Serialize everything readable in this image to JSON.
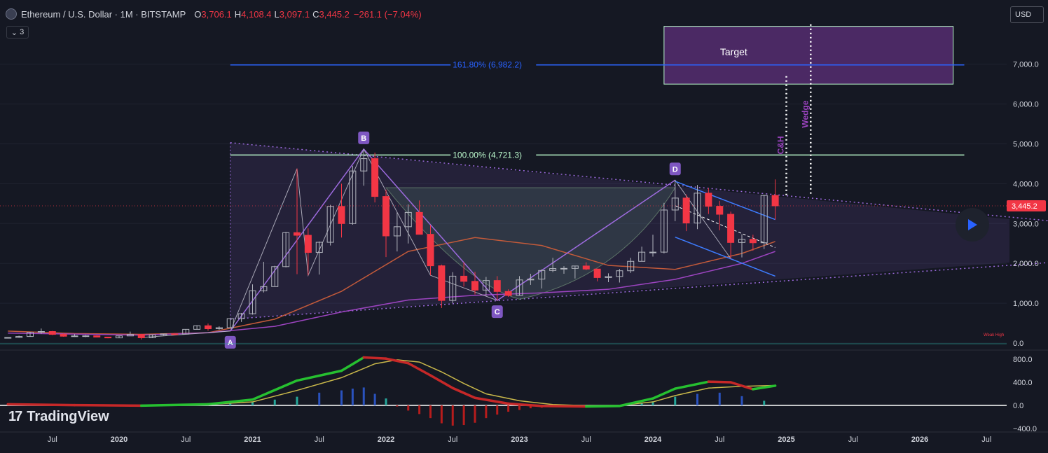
{
  "header": {
    "symbol_title": "Ethereum / U.S. Dollar · 1M · BITSTAMP",
    "ohlc": [
      {
        "k": "O",
        "v": "3,706.1"
      },
      {
        "k": "H",
        "v": "4,108.4"
      },
      {
        "k": "L",
        "v": "3,097.1"
      },
      {
        "k": "C",
        "v": "3,445.2"
      }
    ],
    "change": "−261.1 (−7.04%)",
    "indicators_count": "3",
    "currency": "USD"
  },
  "brand": {
    "name": "TradingView",
    "mark": "17"
  },
  "colors": {
    "background": "#151823",
    "up": "#b2b5be",
    "down": "#f23645",
    "fib_161": "#2962ff",
    "fib_100": "#b9f6ca",
    "pattern": "#9c6ade",
    "target_box": "#8e3fb4",
    "macd_up": "#26c030",
    "macd_down": "#c62828",
    "signal": "#c9b84a"
  },
  "chart_data": [
    {
      "type": "candlestick",
      "title": "Ethereum / U.S. Dollar · 1M · BITSTAMP",
      "y_scale": "linear",
      "ylim": [
        0,
        8000
      ],
      "y_ticks": [
        "0.0",
        "1,000.0",
        "2,000.0",
        "3,000.0",
        "4,000.0",
        "5,000.0",
        "6,000.0",
        "7,000.0"
      ],
      "x_ticks": [
        "Jul",
        "2020",
        "Jul",
        "2021",
        "Jul",
        "2022",
        "Jul",
        "2023",
        "Jul",
        "2024",
        "Jul",
        "2025",
        "Jul",
        "2026",
        "Jul"
      ],
      "last_price_label": "3,445.2",
      "candles": [
        {
          "t": "2019-03",
          "o": 135,
          "h": 145,
          "l": 130,
          "c": 140
        },
        {
          "t": "2019-04",
          "o": 140,
          "h": 185,
          "l": 150,
          "c": 165
        },
        {
          "t": "2019-05",
          "o": 165,
          "h": 280,
          "l": 160,
          "c": 270
        },
        {
          "t": "2019-06",
          "o": 270,
          "h": 365,
          "l": 230,
          "c": 290
        },
        {
          "t": "2019-07",
          "o": 290,
          "h": 305,
          "l": 200,
          "c": 218
        },
        {
          "t": "2019-08",
          "o": 218,
          "h": 240,
          "l": 160,
          "c": 172
        },
        {
          "t": "2019-09",
          "o": 172,
          "h": 225,
          "l": 155,
          "c": 180
        },
        {
          "t": "2019-10",
          "o": 180,
          "h": 200,
          "l": 150,
          "c": 182
        },
        {
          "t": "2019-11",
          "o": 182,
          "h": 195,
          "l": 140,
          "c": 151
        },
        {
          "t": "2019-12",
          "o": 151,
          "h": 155,
          "l": 120,
          "c": 130
        },
        {
          "t": "2020-01",
          "o": 130,
          "h": 185,
          "l": 127,
          "c": 180
        },
        {
          "t": "2020-02",
          "o": 180,
          "h": 288,
          "l": 210,
          "c": 218
        },
        {
          "t": "2020-03",
          "o": 218,
          "h": 230,
          "l": 90,
          "c": 133
        },
        {
          "t": "2020-04",
          "o": 133,
          "h": 215,
          "l": 130,
          "c": 207
        },
        {
          "t": "2020-05",
          "o": 207,
          "h": 230,
          "l": 190,
          "c": 230
        },
        {
          "t": "2020-06",
          "o": 230,
          "h": 250,
          "l": 215,
          "c": 226
        },
        {
          "t": "2020-07",
          "o": 226,
          "h": 350,
          "l": 220,
          "c": 345
        },
        {
          "t": "2020-08",
          "o": 345,
          "h": 445,
          "l": 340,
          "c": 435
        },
        {
          "t": "2020-09",
          "o": 435,
          "h": 490,
          "l": 310,
          "c": 360
        },
        {
          "t": "2020-10",
          "o": 360,
          "h": 420,
          "l": 335,
          "c": 386
        },
        {
          "t": "2020-11",
          "o": 386,
          "h": 620,
          "l": 375,
          "c": 614
        },
        {
          "t": "2020-12",
          "o": 614,
          "h": 755,
          "l": 530,
          "c": 737
        },
        {
          "t": "2021-01",
          "o": 737,
          "h": 1475,
          "l": 715,
          "c": 1313
        },
        {
          "t": "2021-02",
          "o": 1313,
          "h": 2040,
          "l": 1270,
          "c": 1418
        },
        {
          "t": "2021-03",
          "o": 1418,
          "h": 1940,
          "l": 1430,
          "c": 1919
        },
        {
          "t": "2021-04",
          "o": 1919,
          "h": 2790,
          "l": 1900,
          "c": 2772
        },
        {
          "t": "2021-05",
          "o": 2772,
          "h": 4380,
          "l": 1730,
          "c": 2706
        },
        {
          "t": "2021-06",
          "o": 2706,
          "h": 2880,
          "l": 1700,
          "c": 2275
        },
        {
          "t": "2021-07",
          "o": 2275,
          "h": 2550,
          "l": 1720,
          "c": 2530
        },
        {
          "t": "2021-08",
          "o": 2530,
          "h": 3470,
          "l": 2450,
          "c": 3430
        },
        {
          "t": "2021-09",
          "o": 3430,
          "h": 4000,
          "l": 2650,
          "c": 3000
        },
        {
          "t": "2021-10",
          "o": 3000,
          "h": 4450,
          "l": 2970,
          "c": 4320
        },
        {
          "t": "2021-11",
          "o": 4320,
          "h": 4870,
          "l": 3950,
          "c": 4630
        },
        {
          "t": "2021-12",
          "o": 4630,
          "h": 4780,
          "l": 3530,
          "c": 3680
        },
        {
          "t": "2022-01",
          "o": 3680,
          "h": 3850,
          "l": 2160,
          "c": 2690
        },
        {
          "t": "2022-02",
          "o": 2690,
          "h": 3280,
          "l": 2300,
          "c": 2920
        },
        {
          "t": "2022-03",
          "o": 2920,
          "h": 3480,
          "l": 2500,
          "c": 3280
        },
        {
          "t": "2022-04",
          "o": 3280,
          "h": 3580,
          "l": 2730,
          "c": 2730
        },
        {
          "t": "2022-05",
          "o": 2730,
          "h": 2960,
          "l": 1700,
          "c": 1940
        },
        {
          "t": "2022-06",
          "o": 1940,
          "h": 1970,
          "l": 880,
          "c": 1070
        },
        {
          "t": "2022-07",
          "o": 1070,
          "h": 1780,
          "l": 1000,
          "c": 1680
        },
        {
          "t": "2022-08",
          "o": 1680,
          "h": 2030,
          "l": 1420,
          "c": 1550
        },
        {
          "t": "2022-09",
          "o": 1550,
          "h": 1790,
          "l": 1220,
          "c": 1330
        },
        {
          "t": "2022-10",
          "o": 1330,
          "h": 1660,
          "l": 1190,
          "c": 1570
        },
        {
          "t": "2022-11",
          "o": 1570,
          "h": 1680,
          "l": 1070,
          "c": 1295
        },
        {
          "t": "2022-12",
          "o": 1295,
          "h": 1350,
          "l": 1160,
          "c": 1196
        },
        {
          "t": "2023-01",
          "o": 1196,
          "h": 1680,
          "l": 1190,
          "c": 1585
        },
        {
          "t": "2023-02",
          "o": 1585,
          "h": 1740,
          "l": 1460,
          "c": 1605
        },
        {
          "t": "2023-03",
          "o": 1605,
          "h": 1850,
          "l": 1370,
          "c": 1822
        },
        {
          "t": "2023-04",
          "o": 1822,
          "h": 2140,
          "l": 1780,
          "c": 1870
        },
        {
          "t": "2023-05",
          "o": 1870,
          "h": 1930,
          "l": 1740,
          "c": 1875
        },
        {
          "t": "2023-06",
          "o": 1875,
          "h": 1930,
          "l": 1620,
          "c": 1935
        },
        {
          "t": "2023-07",
          "o": 1935,
          "h": 2030,
          "l": 1830,
          "c": 1858
        },
        {
          "t": "2023-08",
          "o": 1858,
          "h": 1870,
          "l": 1550,
          "c": 1645
        },
        {
          "t": "2023-09",
          "o": 1645,
          "h": 1750,
          "l": 1530,
          "c": 1671
        },
        {
          "t": "2023-10",
          "o": 1671,
          "h": 1860,
          "l": 1520,
          "c": 1815
        },
        {
          "t": "2023-11",
          "o": 1815,
          "h": 2140,
          "l": 1760,
          "c": 2052
        },
        {
          "t": "2023-12",
          "o": 2052,
          "h": 2420,
          "l": 2050,
          "c": 2282
        },
        {
          "t": "2024-01",
          "o": 2282,
          "h": 2720,
          "l": 2170,
          "c": 2283
        },
        {
          "t": "2024-02",
          "o": 2283,
          "h": 3520,
          "l": 2250,
          "c": 3340
        },
        {
          "t": "2024-03",
          "o": 3340,
          "h": 4090,
          "l": 3060,
          "c": 3640
        },
        {
          "t": "2024-04",
          "o": 3640,
          "h": 3730,
          "l": 2810,
          "c": 3014
        },
        {
          "t": "2024-05",
          "o": 3014,
          "h": 3970,
          "l": 2860,
          "c": 3763
        },
        {
          "t": "2024-06",
          "o": 3763,
          "h": 3890,
          "l": 3240,
          "c": 3434
        },
        {
          "t": "2024-07",
          "o": 3434,
          "h": 3570,
          "l": 2830,
          "c": 3233
        },
        {
          "t": "2024-08",
          "o": 3233,
          "h": 3300,
          "l": 2120,
          "c": 2525
        },
        {
          "t": "2024-09",
          "o": 2525,
          "h": 2730,
          "l": 2150,
          "c": 2603
        },
        {
          "t": "2024-10",
          "o": 2603,
          "h": 2720,
          "l": 2320,
          "c": 2518
        },
        {
          "t": "2024-11",
          "o": 2518,
          "h": 3720,
          "l": 2360,
          "c": 3706
        },
        {
          "t": "2024-12",
          "o": 3706,
          "h": 4108.4,
          "l": 3097.1,
          "c": 3445.2
        }
      ],
      "moving_averages": [
        {
          "color": "#c35a3a",
          "values": [
            [
              "2019-03",
              300
            ],
            [
              "2019-09",
              240
            ],
            [
              "2020-03",
              220
            ],
            [
              "2020-09",
              260
            ],
            [
              "2021-03",
              600
            ],
            [
              "2021-09",
              1300
            ],
            [
              "2022-03",
              2300
            ],
            [
              "2022-09",
              2650
            ],
            [
              "2023-03",
              2450
            ],
            [
              "2023-09",
              1950
            ],
            [
              "2024-03",
              1850
            ],
            [
              "2024-09",
              2250
            ],
            [
              "2024-12",
              2550
            ]
          ]
        },
        {
          "color": "#9c44c0",
          "values": [
            [
              "2019-03",
              250
            ],
            [
              "2020-03",
              200
            ],
            [
              "2020-09",
              260
            ],
            [
              "2021-03",
              420
            ],
            [
              "2021-09",
              780
            ],
            [
              "2022-03",
              1080
            ],
            [
              "2022-09",
              1200
            ],
            [
              "2023-03",
              1260
            ],
            [
              "2023-09",
              1350
            ],
            [
              "2024-03",
              1600
            ],
            [
              "2024-09",
              2000
            ],
            [
              "2024-12",
              2300
            ]
          ]
        }
      ],
      "annotations": {
        "fib_levels": [
          {
            "label": "161.80% (6,982.2)",
            "price": 6982.2
          },
          {
            "label": "100.00% (4,721.3)",
            "price": 4721.3
          }
        ],
        "target_box": {
          "label": "Target",
          "price_low": 6500,
          "price_high": 7950,
          "from": "2024-02",
          "to": "2026-04"
        },
        "vertical_markers": [
          {
            "label": "C&H",
            "at": "2025-01",
            "price_from": 3650,
            "price_to": 6700
          },
          {
            "label": "Wedge",
            "at": "2025-03",
            "price_from": 3750,
            "price_to": 8000
          }
        ],
        "pattern_points": [
          {
            "label": "A",
            "t": "2020-11",
            "price": 300
          },
          {
            "label": "B",
            "t": "2021-11",
            "price": 4870
          },
          {
            "label": "C",
            "t": "2022-11",
            "price": 1070
          },
          {
            "label": "D",
            "t": "2024-03",
            "price": 4090
          }
        ],
        "weak_high_label": "Weak High"
      }
    },
    {
      "type": "macd",
      "ylim": [
        -400,
        800
      ],
      "y_ticks": [
        "800.0",
        "400.0",
        "0.0",
        "−400.0"
      ],
      "macd": [
        [
          "2019-03",
          20
        ],
        [
          "2019-09",
          5
        ],
        [
          "2020-03",
          -5
        ],
        [
          "2020-09",
          20
        ],
        [
          "2021-01",
          100
        ],
        [
          "2021-05",
          430
        ],
        [
          "2021-09",
          600
        ],
        [
          "2021-11",
          830
        ],
        [
          "2022-01",
          810
        ],
        [
          "2022-03",
          730
        ],
        [
          "2022-05",
          520
        ],
        [
          "2022-07",
          300
        ],
        [
          "2022-09",
          130
        ],
        [
          "2022-12",
          30
        ],
        [
          "2023-03",
          -10
        ],
        [
          "2023-07",
          -20
        ],
        [
          "2023-10",
          -10
        ],
        [
          "2024-01",
          120
        ],
        [
          "2024-03",
          290
        ],
        [
          "2024-06",
          410
        ],
        [
          "2024-08",
          400
        ],
        [
          "2024-10",
          280
        ],
        [
          "2024-12",
          340
        ]
      ],
      "signal": [
        [
          "2019-03",
          10
        ],
        [
          "2019-09",
          8
        ],
        [
          "2020-03",
          5
        ],
        [
          "2020-09",
          15
        ],
        [
          "2021-01",
          60
        ],
        [
          "2021-05",
          260
        ],
        [
          "2021-09",
          480
        ],
        [
          "2021-12",
          720
        ],
        [
          "2022-02",
          790
        ],
        [
          "2022-04",
          750
        ],
        [
          "2022-06",
          580
        ],
        [
          "2022-08",
          380
        ],
        [
          "2022-10",
          200
        ],
        [
          "2023-01",
          80
        ],
        [
          "2023-04",
          15
        ],
        [
          "2023-07",
          -5
        ],
        [
          "2023-10",
          0
        ],
        [
          "2024-01",
          60
        ],
        [
          "2024-03",
          170
        ],
        [
          "2024-06",
          300
        ],
        [
          "2024-09",
          330
        ],
        [
          "2024-12",
          345
        ]
      ],
      "histogram": [
        [
          "2020-09",
          5
        ],
        [
          "2020-11",
          30
        ],
        [
          "2021-01",
          60
        ],
        [
          "2021-03",
          100
        ],
        [
          "2021-05",
          150
        ],
        [
          "2021-07",
          220
        ],
        [
          "2021-09",
          260
        ],
        [
          "2021-10",
          290
        ],
        [
          "2021-11",
          310
        ],
        [
          "2021-12",
          200
        ],
        [
          "2022-01",
          120
        ],
        [
          "2022-02",
          -20
        ],
        [
          "2022-03",
          -90
        ],
        [
          "2022-04",
          -150
        ],
        [
          "2022-05",
          -220
        ],
        [
          "2022-06",
          -310
        ],
        [
          "2022-07",
          -350
        ],
        [
          "2022-08",
          -340
        ],
        [
          "2022-09",
          -300
        ],
        [
          "2022-10",
          -220
        ],
        [
          "2022-11",
          -160
        ],
        [
          "2022-12",
          -110
        ],
        [
          "2023-01",
          -80
        ],
        [
          "2023-02",
          -50
        ],
        [
          "2023-03",
          -40
        ],
        [
          "2023-05",
          -20
        ],
        [
          "2023-07",
          -10
        ],
        [
          "2023-10",
          10
        ],
        [
          "2023-12",
          40
        ],
        [
          "2024-01",
          70
        ],
        [
          "2024-03",
          150
        ],
        [
          "2024-05",
          200
        ],
        [
          "2024-07",
          220
        ],
        [
          "2024-09",
          160
        ],
        [
          "2024-11",
          80
        ]
      ]
    }
  ]
}
